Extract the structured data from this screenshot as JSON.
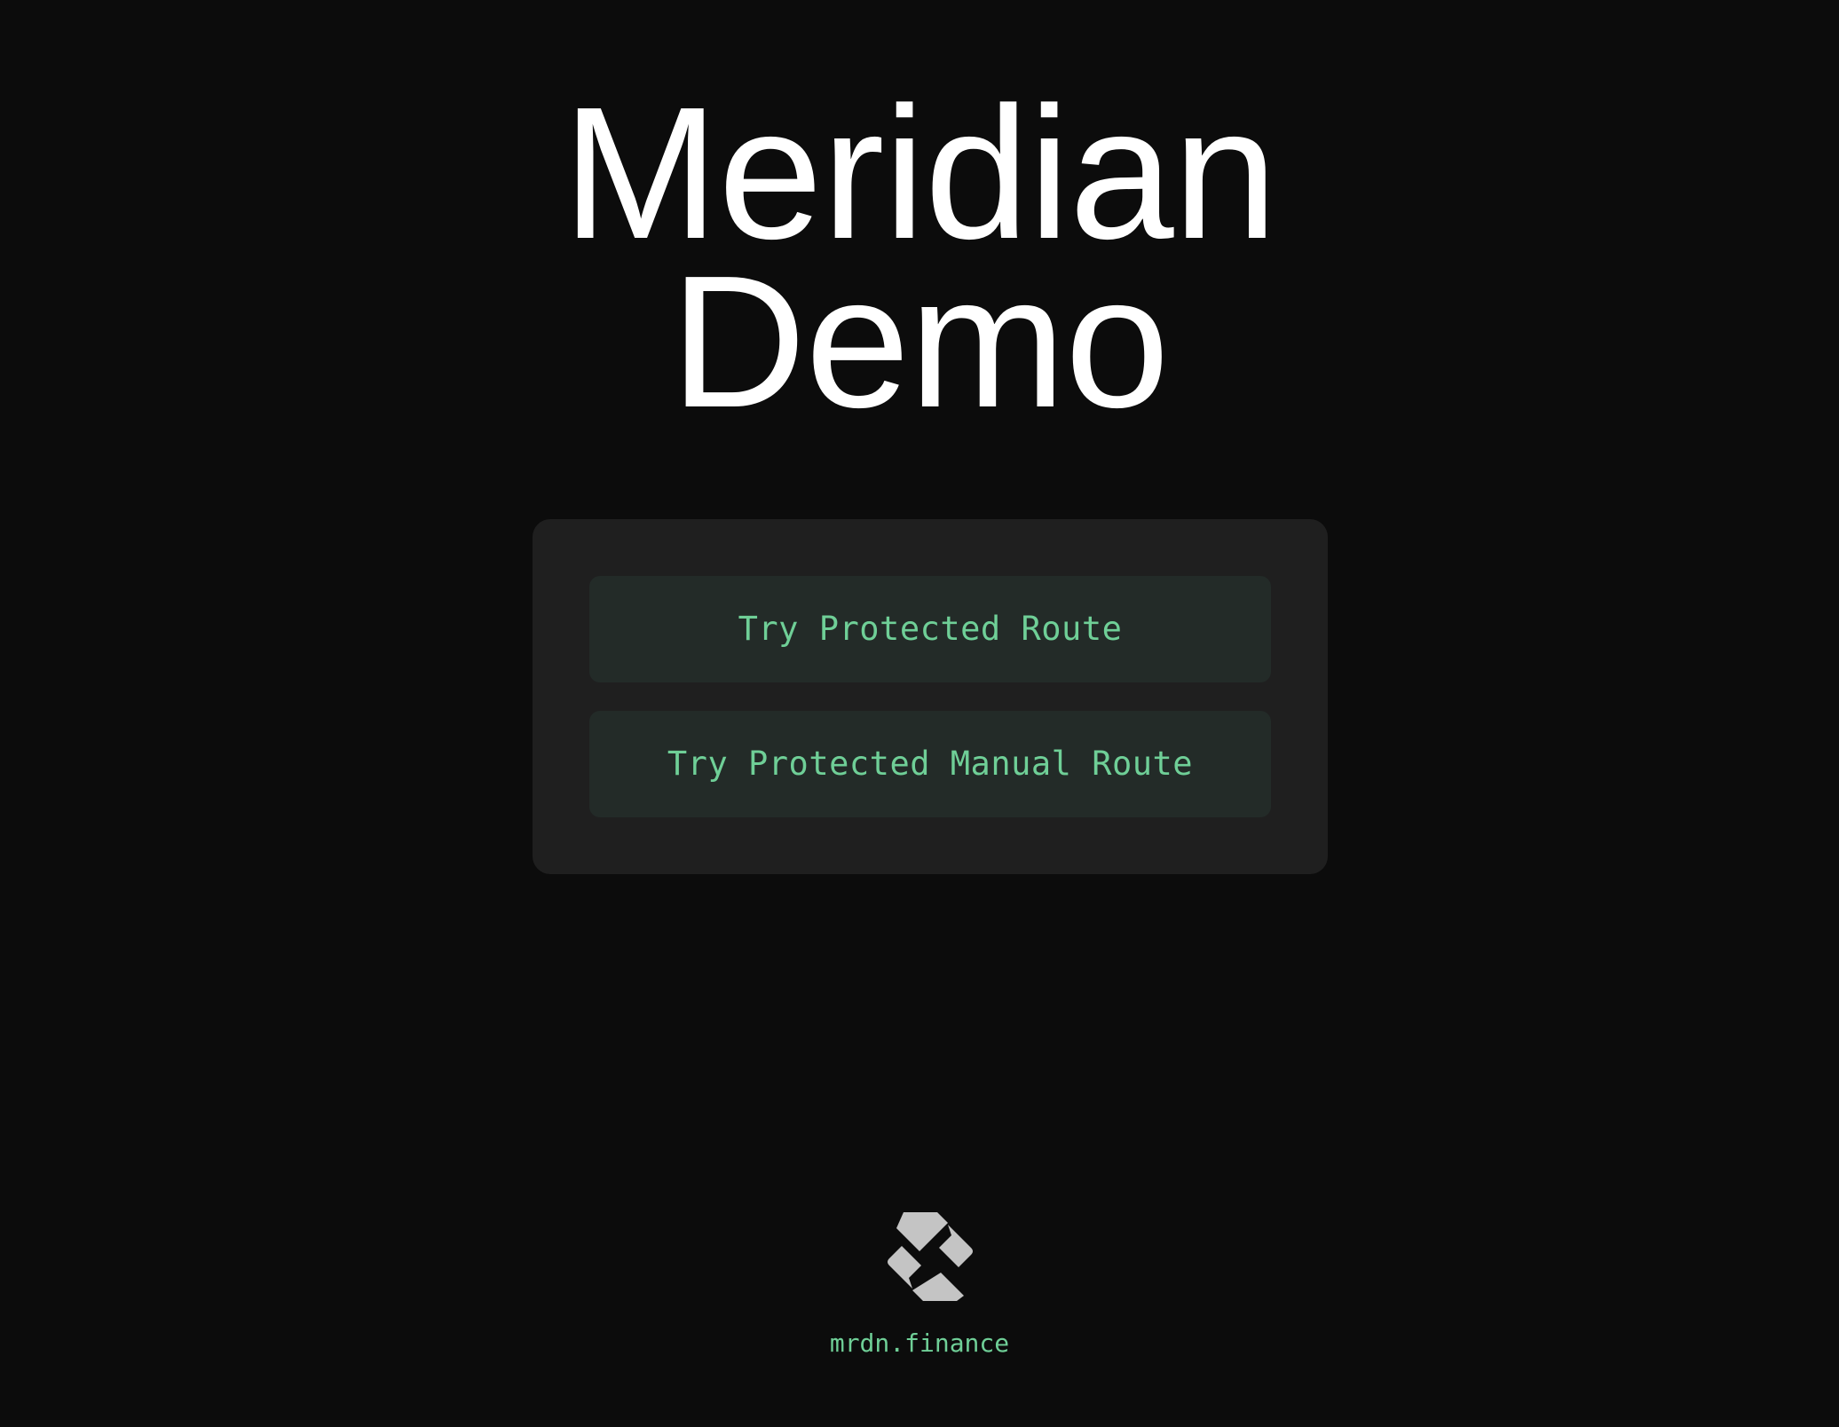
{
  "hero": {
    "title_line1": "Meridian",
    "title_line2": "Demo"
  },
  "actions": {
    "protected_route_label": "Try Protected Route",
    "protected_manual_route_label": "Try Protected Manual Route"
  },
  "footer": {
    "logo_icon": "meridian-logo-icon",
    "link_text": "mrdn.finance"
  },
  "colors": {
    "background": "#0c0c0c",
    "panel": "#1f1f1f",
    "button": "#232b28",
    "accent": "#6fcf97",
    "title": "#ffffff",
    "logo": "#c4c4c4"
  }
}
